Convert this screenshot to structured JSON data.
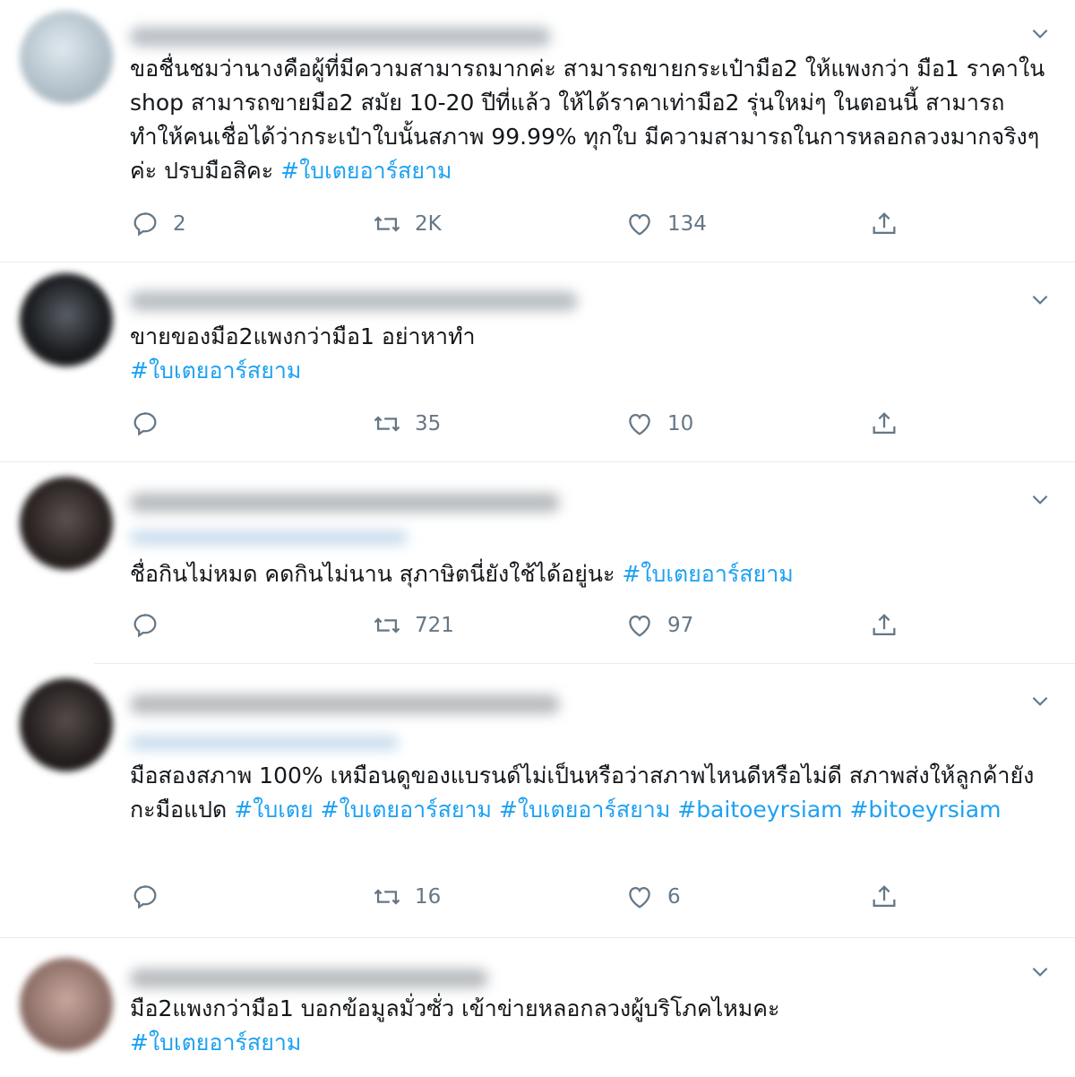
{
  "tweets": [
    {
      "text_plain": "ขอชื่นชมว่านางคือผู้ที่มีความสามารถมากค่ะ สามารถขายกระเป๋ามือ2 ให้แพงกว่า มือ1 ราคาใน shop สามารถขายมือ2 สมัย 10-20 ปีที่แล้ว ให้ได้ราคาเท่ามือ2 รุ่นใหม่ๆ ในตอนนี้ สามารถทำให้คนเชื่อได้ว่ากระเป๋าใบนั้นสภาพ 99.99% ทุกใบ มีความสามารถในการหลอกลวงมากจริงๆ ค่ะ ปรบมือสิคะ ",
      "hashtags": "#ใบเตยอาร์สยาม",
      "replies": "2",
      "retweets": "2K",
      "likes": "134"
    },
    {
      "text_plain": "ขายของมือ2แพงกว่ามือ1 อย่าหาทำ",
      "hashtags": "#ใบเตยอาร์สยาม",
      "replies": "",
      "retweets": "35",
      "likes": "10"
    },
    {
      "text_plain": "ชื่อกินไม่หมด คดกินไม่นาน สุภาษิตนี่ยังใช้ได้อยู่นะ ",
      "hashtags": "#ใบเตยอาร์สยาม",
      "replies": "",
      "retweets": "721",
      "likes": "97"
    },
    {
      "text_plain": "มือสองสภาพ 100% เหมือนดูของแบรนด์ไม่เป็นหรือว่าสภาพไหนดีหรือไม่ดี สภาพส่งให้ลูกค้ายังกะมือแปด ",
      "hashtags": "#ใบเตย #ใบเตยอาร์สยาม #ใบเตยอาร์สยาม #baitoeyrsiam #bitoeyrsiam",
      "replies": "",
      "retweets": "16",
      "likes": "6"
    },
    {
      "text_plain": "มือ2แพงกว่ามือ1 บอกข้อมูลมั่วซั่ว เข้าข่ายหลอกลวงผู้บริโภคไหมคะ",
      "hashtags": "#ใบเตยอาร์สยาม"
    }
  ],
  "icons": {
    "reply": "reply-icon",
    "retweet": "retweet-icon",
    "like": "like-icon",
    "share": "share-icon",
    "more": "chevron-down-icon"
  },
  "colors": {
    "hashtag": "#1da1f2",
    "muted": "#657786",
    "separator": "#e6ecf0"
  }
}
